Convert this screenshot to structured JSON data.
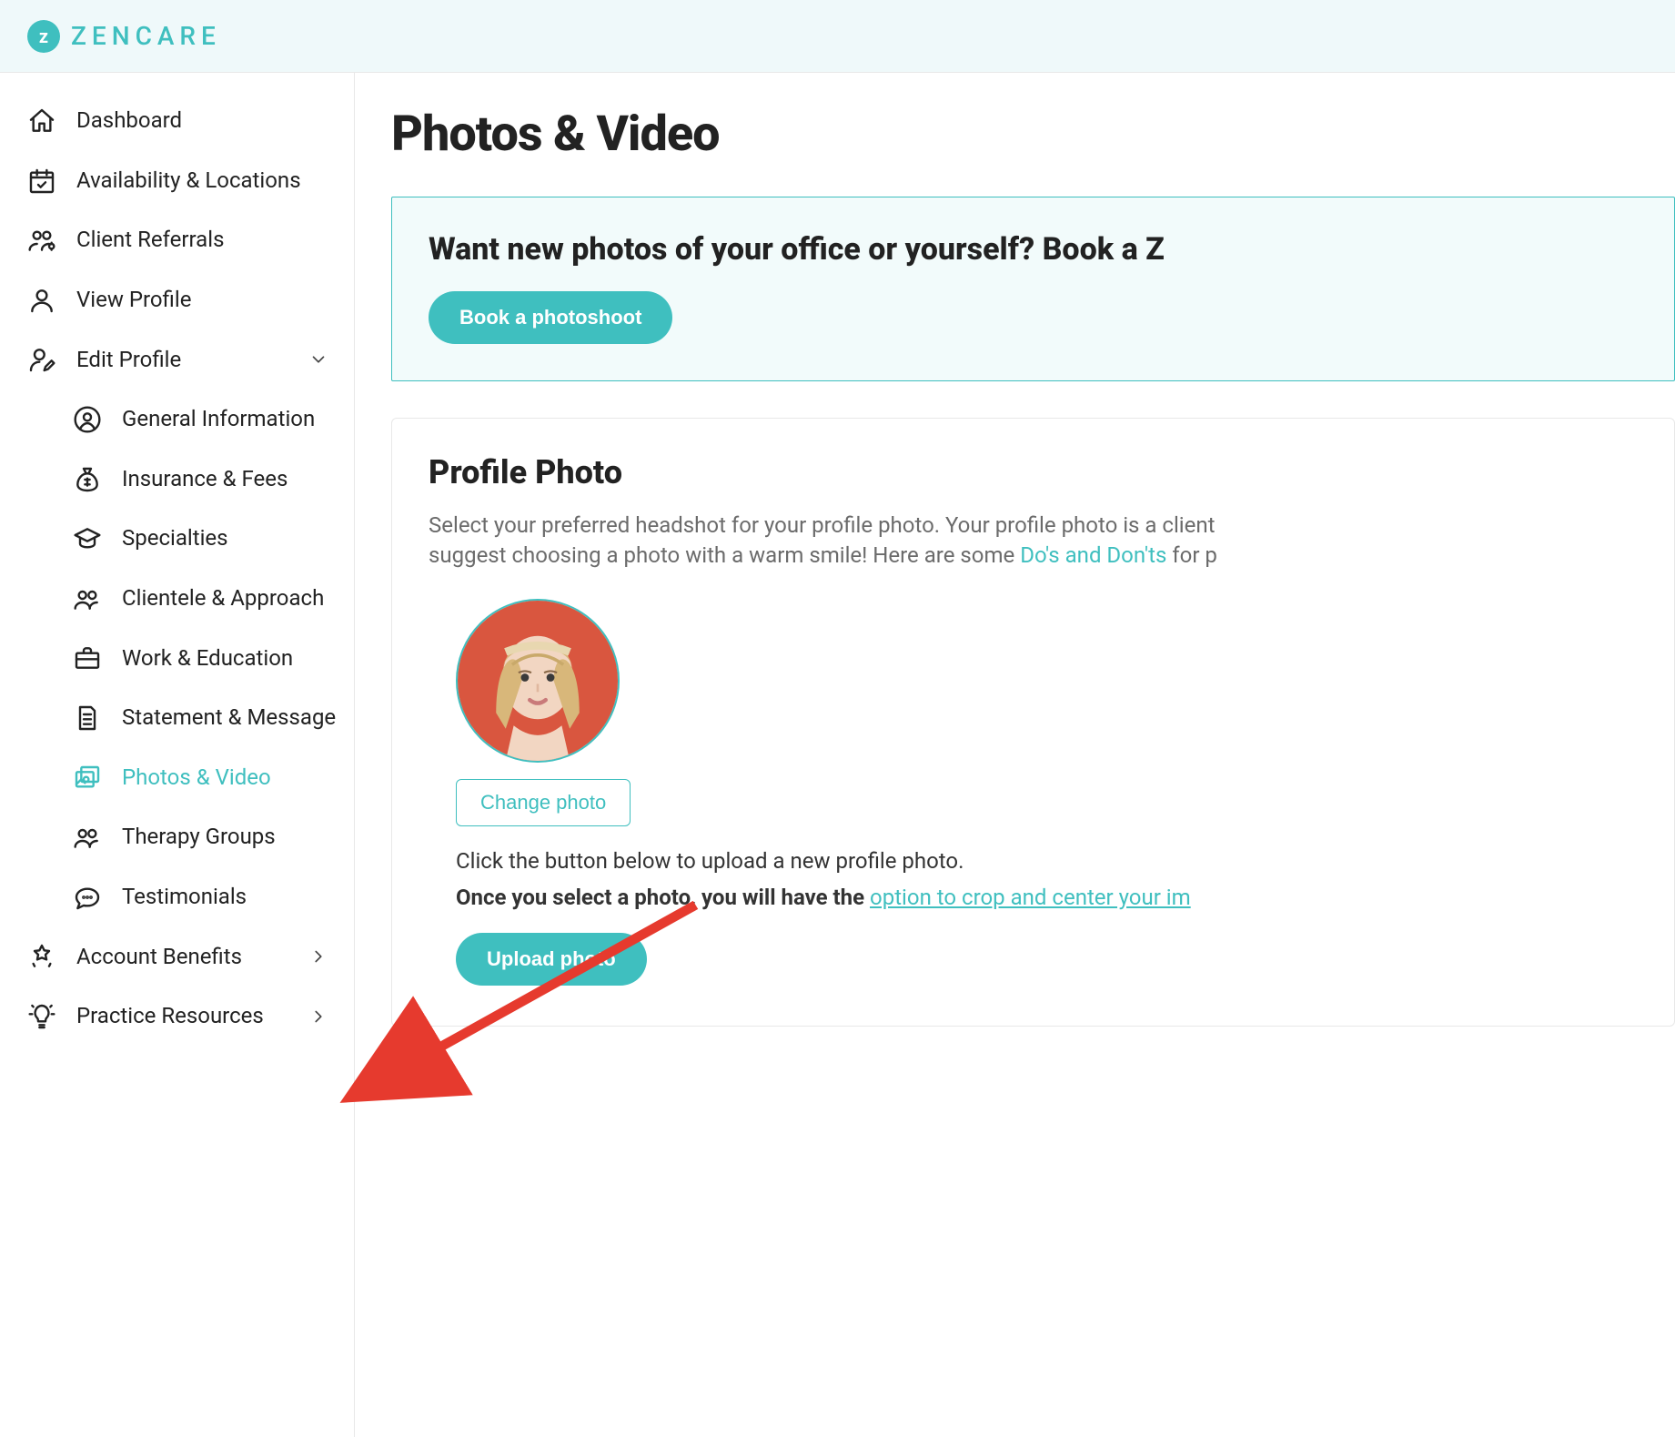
{
  "brand": {
    "name": "ZENCARE",
    "mark": "z"
  },
  "sidebar": {
    "items": [
      {
        "label": "Dashboard",
        "icon": "home"
      },
      {
        "label": "Availability & Locations",
        "icon": "calendar"
      },
      {
        "label": "Client Referrals",
        "icon": "referrals"
      },
      {
        "label": "View Profile",
        "icon": "person"
      },
      {
        "label": "Edit Profile",
        "icon": "edit-person",
        "expandable": true
      }
    ],
    "edit_profile_children": [
      {
        "label": "General Information",
        "icon": "user-circle"
      },
      {
        "label": "Insurance & Fees",
        "icon": "money-bag"
      },
      {
        "label": "Specialties",
        "icon": "grad-cap"
      },
      {
        "label": "Clientele & Approach",
        "icon": "people"
      },
      {
        "label": "Work & Education",
        "icon": "briefcase"
      },
      {
        "label": "Statement & Message",
        "icon": "doc"
      },
      {
        "label": "Photos & Video",
        "icon": "photos",
        "active": true
      },
      {
        "label": "Therapy Groups",
        "icon": "people"
      },
      {
        "label": "Testimonials",
        "icon": "chat"
      }
    ],
    "bottom_items": [
      {
        "label": "Account Benefits",
        "icon": "stars"
      },
      {
        "label": "Practice Resources",
        "icon": "bulb"
      }
    ]
  },
  "page": {
    "title": "Photos & Video",
    "banner": {
      "title": "Want new photos of your office or yourself? Book a Z",
      "cta": "Book a photoshoot"
    },
    "profile_photo": {
      "title": "Profile Photo",
      "desc_1": "Select your preferred headshot for your profile photo. Your profile photo is a client",
      "desc_2a": "suggest choosing a photo with a warm smile! Here are some ",
      "desc_2_link": "Do's and Don'ts",
      "desc_2b": " for p",
      "change_label": "Change photo",
      "upload_hint": "Click the button below to upload a new profile photo.",
      "upload_hint_bold": "Once you select a photo, you will have the ",
      "upload_hint_link": "option to crop and center your im",
      "upload_label": "Upload photo"
    }
  }
}
